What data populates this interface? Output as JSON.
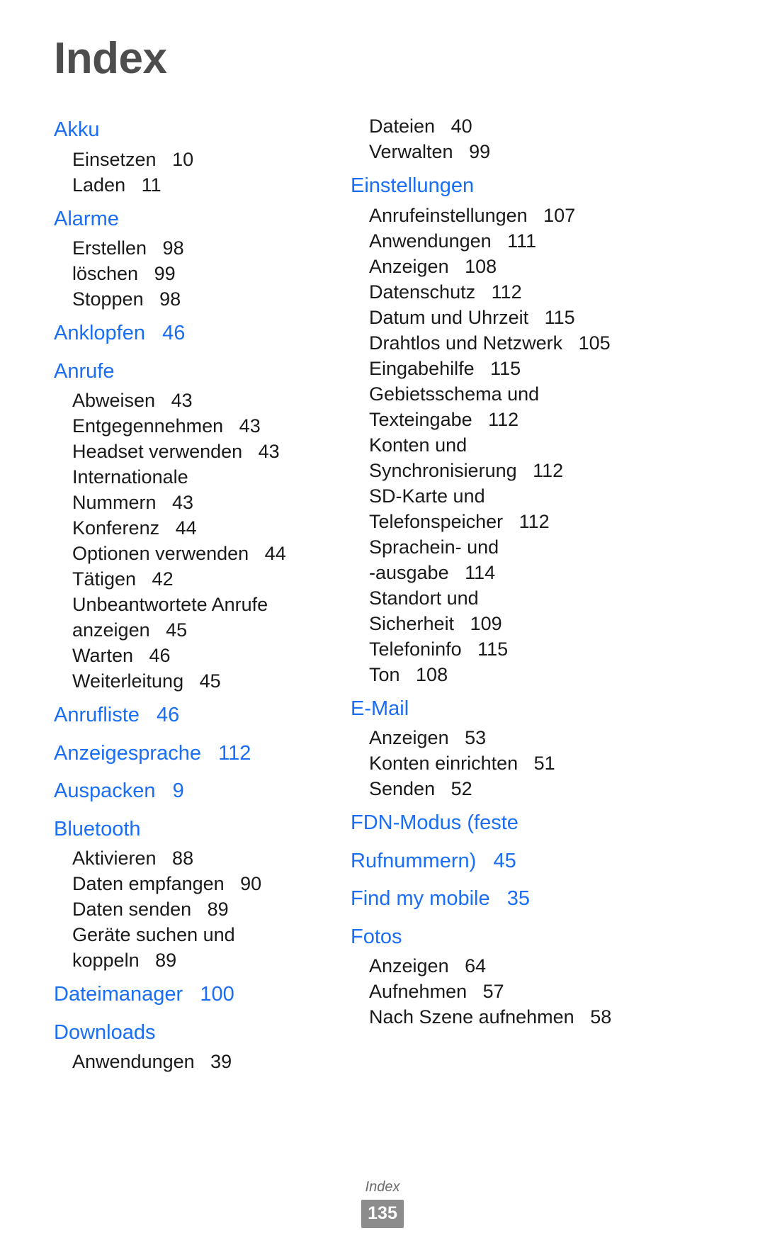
{
  "page": {
    "title": "Index",
    "footer_label": "Index",
    "page_number": "135",
    "accent_color": "#1a6ef5",
    "title_color": "#4d4d4d",
    "text_color": "#1a1a1a",
    "badge_color": "#8c8c8c"
  },
  "columns": {
    "left": [
      {
        "type": "heading",
        "text": "Akku"
      },
      {
        "type": "subentry",
        "text": "Einsetzen   10"
      },
      {
        "type": "subentry",
        "text": "Laden   11"
      },
      {
        "type": "heading",
        "text": "Alarme"
      },
      {
        "type": "subentry",
        "text": "Erstellen   98"
      },
      {
        "type": "subentry",
        "text": "löschen   99"
      },
      {
        "type": "subentry",
        "text": "Stoppen   98"
      },
      {
        "type": "heading",
        "text": "Anklopfen   46"
      },
      {
        "type": "heading",
        "text": "Anrufe"
      },
      {
        "type": "subentry",
        "text": "Abweisen   43"
      },
      {
        "type": "subentry",
        "text": "Entgegennehmen   43"
      },
      {
        "type": "subentry",
        "text": "Headset verwenden   43"
      },
      {
        "type": "subentry",
        "text": "Internationale"
      },
      {
        "type": "subentry",
        "text": "Nummern   43"
      },
      {
        "type": "subentry",
        "text": "Konferenz   44"
      },
      {
        "type": "subentry",
        "text": "Optionen verwenden   44"
      },
      {
        "type": "subentry",
        "text": "Tätigen   42"
      },
      {
        "type": "subentry",
        "text": "Unbeantwortete Anrufe"
      },
      {
        "type": "subentry",
        "text": "anzeigen   45"
      },
      {
        "type": "subentry",
        "text": "Warten   46"
      },
      {
        "type": "subentry",
        "text": "Weiterleitung   45"
      },
      {
        "type": "heading",
        "text": "Anrufliste   46"
      },
      {
        "type": "heading",
        "text": "Anzeigesprache   112"
      },
      {
        "type": "heading",
        "text": "Auspacken   9"
      },
      {
        "type": "heading",
        "text": "Bluetooth"
      },
      {
        "type": "subentry",
        "text": "Aktivieren   88"
      },
      {
        "type": "subentry",
        "text": "Daten empfangen   90"
      },
      {
        "type": "subentry",
        "text": "Daten senden   89"
      },
      {
        "type": "subentry",
        "text": "Geräte suchen und"
      },
      {
        "type": "subentry",
        "text": "koppeln   89"
      },
      {
        "type": "heading",
        "text": "Dateimanager   100"
      },
      {
        "type": "heading",
        "text": "Downloads"
      },
      {
        "type": "subentry",
        "text": "Anwendungen   39"
      }
    ],
    "right": [
      {
        "type": "subentry",
        "text": "Dateien   40"
      },
      {
        "type": "subentry",
        "text": "Verwalten   99"
      },
      {
        "type": "heading",
        "text": "Einstellungen"
      },
      {
        "type": "subentry",
        "text": "Anrufeinstellungen   107"
      },
      {
        "type": "subentry",
        "text": "Anwendungen   111"
      },
      {
        "type": "subentry",
        "text": "Anzeigen   108"
      },
      {
        "type": "subentry",
        "text": "Datenschutz   112"
      },
      {
        "type": "subentry",
        "text": "Datum und Uhrzeit   115"
      },
      {
        "type": "subentry",
        "text": "Drahtlos und Netzwerk   105"
      },
      {
        "type": "subentry",
        "text": "Eingabehilfe   115"
      },
      {
        "type": "subentry",
        "text": "Gebietsschema und"
      },
      {
        "type": "subentry",
        "text": "Texteingabe   112"
      },
      {
        "type": "subentry",
        "text": "Konten und"
      },
      {
        "type": "subentry",
        "text": "Synchronisierung   112"
      },
      {
        "type": "subentry",
        "text": "SD-Karte und"
      },
      {
        "type": "subentry",
        "text": "Telefonspeicher   112"
      },
      {
        "type": "subentry",
        "text": "Sprachein- und"
      },
      {
        "type": "subentry",
        "text": "-ausgabe   114"
      },
      {
        "type": "subentry",
        "text": "Standort und"
      },
      {
        "type": "subentry",
        "text": "Sicherheit   109"
      },
      {
        "type": "subentry",
        "text": "Telefoninfo   115"
      },
      {
        "type": "subentry",
        "text": "Ton   108"
      },
      {
        "type": "heading",
        "text": "E-Mail"
      },
      {
        "type": "subentry",
        "text": "Anzeigen   53"
      },
      {
        "type": "subentry",
        "text": "Konten einrichten   51"
      },
      {
        "type": "subentry",
        "text": "Senden   52"
      },
      {
        "type": "heading",
        "text": "FDN-Modus (feste"
      },
      {
        "type": "heading",
        "text": "Rufnummern)   45"
      },
      {
        "type": "heading",
        "text": "Find my mobile   35"
      },
      {
        "type": "heading",
        "text": "Fotos"
      },
      {
        "type": "subentry",
        "text": "Anzeigen   64"
      },
      {
        "type": "subentry",
        "text": "Aufnehmen   57"
      },
      {
        "type": "subentry",
        "text": "Nach Szene aufnehmen   58"
      }
    ]
  }
}
